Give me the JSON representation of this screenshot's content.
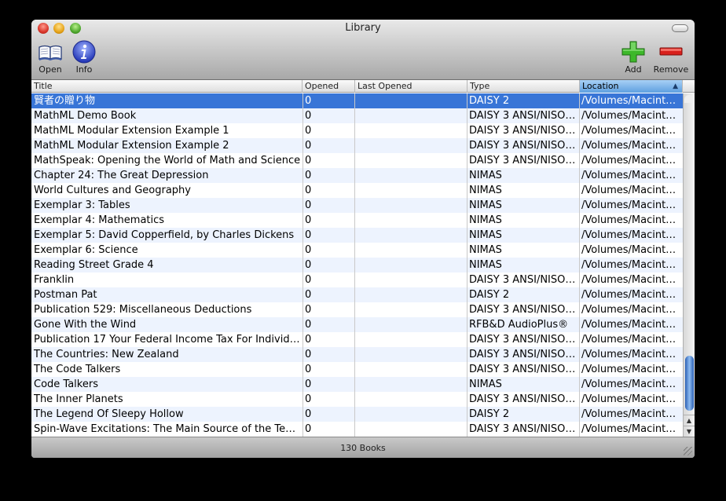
{
  "window": {
    "title": "Library"
  },
  "toolbar": {
    "open_label": "Open",
    "info_label": "Info",
    "add_label": "Add",
    "remove_label": "Remove"
  },
  "columns": {
    "title": "Title",
    "opened": "Opened",
    "last_opened": "Last Opened",
    "type": "Type",
    "location": "Location"
  },
  "sort": {
    "column": "Location",
    "direction": "ascending"
  },
  "rows": [
    {
      "title": "賢者の贈り物",
      "opened": "0",
      "last_opened": "",
      "type": "DAISY 2",
      "location": "/Volumes/Macint…"
    },
    {
      "title": "MathML Demo Book",
      "opened": "0",
      "last_opened": "",
      "type": "DAISY 3 ANSI/NISO…",
      "location": "/Volumes/Macint…"
    },
    {
      "title": "MathML Modular Extension Example 1",
      "opened": "0",
      "last_opened": "",
      "type": "DAISY 3 ANSI/NISO…",
      "location": "/Volumes/Macint…"
    },
    {
      "title": "MathML Modular Extension Example 2",
      "opened": "0",
      "last_opened": "",
      "type": "DAISY 3 ANSI/NISO…",
      "location": "/Volumes/Macint…"
    },
    {
      "title": "MathSpeak: Opening the World of Math and Science",
      "opened": "0",
      "last_opened": "",
      "type": "DAISY 3 ANSI/NISO…",
      "location": "/Volumes/Macint…"
    },
    {
      "title": "Chapter 24: The Great Depression",
      "opened": "0",
      "last_opened": "",
      "type": "NIMAS",
      "location": "/Volumes/Macint…"
    },
    {
      "title": "World Cultures and Geography",
      "opened": "0",
      "last_opened": "",
      "type": "NIMAS",
      "location": "/Volumes/Macint…"
    },
    {
      "title": "Exemplar 3: Tables",
      "opened": "0",
      "last_opened": "",
      "type": "NIMAS",
      "location": "/Volumes/Macint…"
    },
    {
      "title": "Exemplar 4: Mathematics",
      "opened": "0",
      "last_opened": "",
      "type": "NIMAS",
      "location": "/Volumes/Macint…"
    },
    {
      "title": "Exemplar 5: David Copperfield, by Charles Dickens",
      "opened": "0",
      "last_opened": "",
      "type": "NIMAS",
      "location": "/Volumes/Macint…"
    },
    {
      "title": "Exemplar 6: Science",
      "opened": "0",
      "last_opened": "",
      "type": "NIMAS",
      "location": "/Volumes/Macint…"
    },
    {
      "title": "Reading Street Grade 4",
      "opened": "0",
      "last_opened": "",
      "type": "NIMAS",
      "location": "/Volumes/Macint…"
    },
    {
      "title": "Franklin",
      "opened": "0",
      "last_opened": "",
      "type": "DAISY 3 ANSI/NISO…",
      "location": "/Volumes/Macint…"
    },
    {
      "title": "Postman Pat",
      "opened": "0",
      "last_opened": "",
      "type": "DAISY 2",
      "location": "/Volumes/Macint…"
    },
    {
      "title": "Publication 529: Miscellaneous Deductions",
      "opened": "0",
      "last_opened": "",
      "type": "DAISY 3 ANSI/NISO…",
      "location": "/Volumes/Macint…"
    },
    {
      "title": "Gone With the Wind",
      "opened": "0",
      "last_opened": "",
      "type": "RFB&D AudioPlus®",
      "location": "/Volumes/Macint…"
    },
    {
      "title": "Publication 17 Your Federal Income Tax For Individ…",
      "opened": "0",
      "last_opened": "",
      "type": "DAISY 3 ANSI/NISO…",
      "location": "/Volumes/Macint…"
    },
    {
      "title": "The Countries: New Zealand",
      "opened": "0",
      "last_opened": "",
      "type": "DAISY 3 ANSI/NISO…",
      "location": "/Volumes/Macint…"
    },
    {
      "title": "The Code Talkers",
      "opened": "0",
      "last_opened": "",
      "type": "DAISY 3 ANSI/NISO…",
      "location": "/Volumes/Macint…"
    },
    {
      "title": "Code Talkers",
      "opened": "0",
      "last_opened": "",
      "type": "NIMAS",
      "location": "/Volumes/Macint…"
    },
    {
      "title": "The Inner Planets",
      "opened": "0",
      "last_opened": "",
      "type": "DAISY 3 ANSI/NISO…",
      "location": "/Volumes/Macint…"
    },
    {
      "title": "The Legend Of Sleepy Hollow",
      "opened": "0",
      "last_opened": "",
      "type": "DAISY 2",
      "location": "/Volumes/Macint…"
    },
    {
      "title": "Spin-Wave Excitations: The Main Source of the Te…",
      "opened": "0",
      "last_opened": "",
      "type": "DAISY 3 ANSI/NISO…",
      "location": "/Volumes/Macint…"
    }
  ],
  "selected_row": 0,
  "status": {
    "text": "130 Books"
  },
  "colors": {
    "selection": "#3875d7",
    "alt_row": "#edf3fe",
    "add": "#3db82a",
    "remove": "#d8201c",
    "info": "#3a55d6"
  }
}
